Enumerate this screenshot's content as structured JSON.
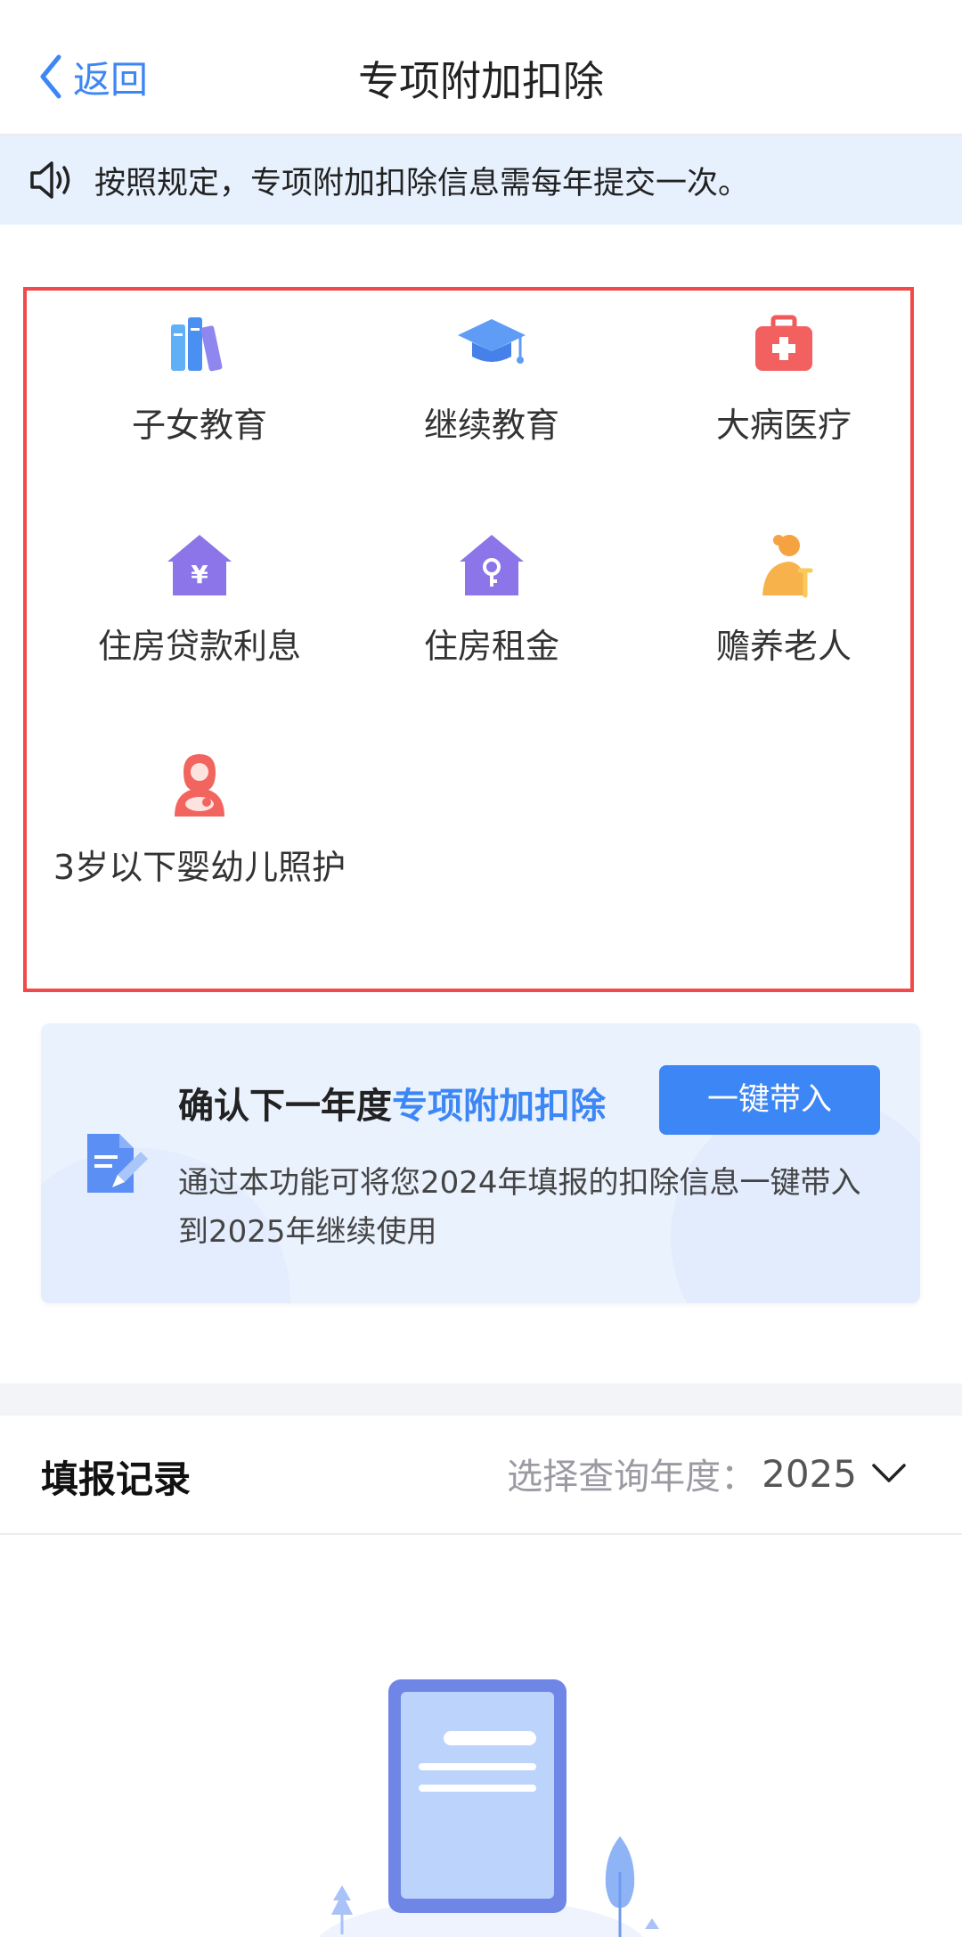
{
  "nav": {
    "back_label": "返回",
    "title": "专项附加扣除"
  },
  "notice": {
    "icon": "speaker-icon",
    "text": "按照规定，专项附加扣除信息需每年提交一次。"
  },
  "categories": [
    {
      "label": "子女教育",
      "icon": "books-icon"
    },
    {
      "label": "继续教育",
      "icon": "graduation-cap-icon"
    },
    {
      "label": "大病医疗",
      "icon": "medical-kit-icon"
    },
    {
      "label": "住房贷款利息",
      "icon": "house-yuan-icon"
    },
    {
      "label": "住房租金",
      "icon": "house-key-icon"
    },
    {
      "label": "赡养老人",
      "icon": "elderly-person-icon"
    },
    {
      "label": "3岁以下婴幼儿照护",
      "icon": "mother-baby-icon"
    }
  ],
  "confirm_card": {
    "title_prefix": "确认下一年度",
    "title_highlight": "专项附加扣除",
    "button_label": "一键带入",
    "description": "通过本功能可将您2024年填报的扣除信息一键带入到2025年继续使用",
    "icon": "edit-document-icon"
  },
  "records": {
    "title": "填报记录",
    "year_label": "选择查询年度：",
    "year_value": "2025"
  },
  "colors": {
    "accent": "#3d86f5",
    "highlight_border": "#f04a4a",
    "notice_bg": "#e7f1fd"
  }
}
